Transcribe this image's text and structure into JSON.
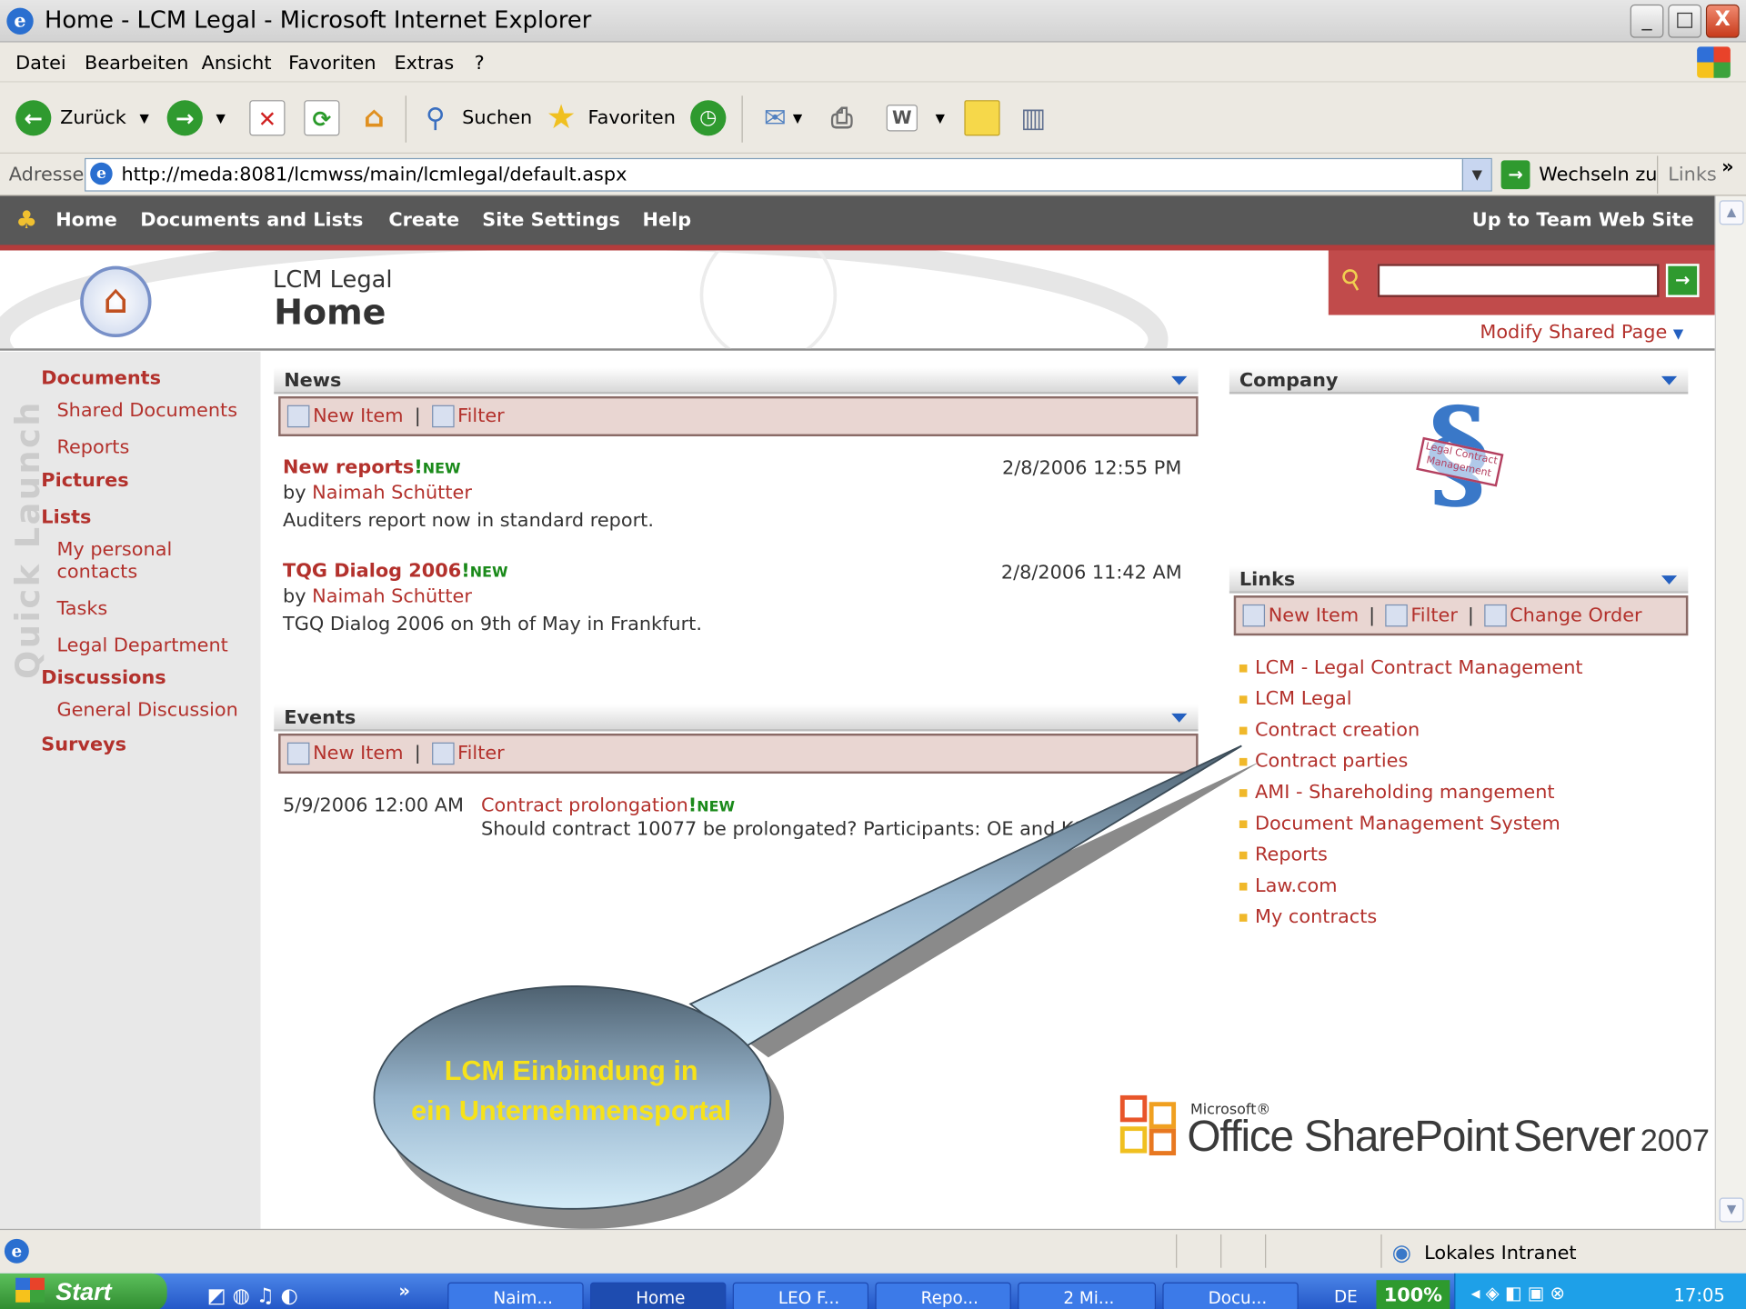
{
  "window": {
    "title": "Home - LCM Legal - Microsoft Internet Explorer",
    "min": "_",
    "max": "□",
    "close": "X"
  },
  "menu": [
    "Datei",
    "Bearbeiten",
    "Ansicht",
    "Favoriten",
    "Extras",
    "?"
  ],
  "toolbar": {
    "back": "Zurück",
    "search": "Suchen",
    "favorites": "Favoriten"
  },
  "address": {
    "label": "Adresse",
    "url": "http://meda:8081/lcmwss/main/lcmlegal/default.aspx",
    "go": "Wechseln zu",
    "links": "Links",
    "more": "»"
  },
  "sp_nav": {
    "home": "Home",
    "docs": "Documents and Lists",
    "create": "Create",
    "settings": "Site Settings",
    "help": "Help",
    "up": "Up to Team Web Site"
  },
  "header": {
    "site": "LCM Legal",
    "page": "Home",
    "modify": "Modify Shared Page"
  },
  "quicklaunch": {
    "label": "Quick Launch",
    "documents": "Documents",
    "shared_docs": "Shared Documents",
    "reports": "Reports",
    "pictures": "Pictures",
    "lists": "Lists",
    "contacts_1": "My personal",
    "contacts_2": "contacts",
    "tasks": "Tasks",
    "legal": "Legal Department",
    "discussions": "Discussions",
    "general": "General Discussion",
    "surveys": "Surveys"
  },
  "news": {
    "title": "News",
    "new_item": "New Item",
    "sep": "|",
    "filter": "Filter",
    "items": [
      {
        "title": "New reports",
        "badge": "NEW",
        "date": "2/8/2006 12:55 PM",
        "by": "by",
        "author": "Naimah Schütter",
        "body": "Auditers report now in standard report."
      },
      {
        "title": "TQG Dialog 2006",
        "badge": "NEW",
        "date": "2/8/2006 11:42 AM",
        "by": "by",
        "author": "Naimah Schütter",
        "body": "TGQ Dialog 2006 on 9th of May in Frankfurt."
      }
    ]
  },
  "events": {
    "title": "Events",
    "new_item": "New Item",
    "sep": "|",
    "filter": "Filter",
    "item": {
      "date": "5/9/2006 12:00 AM",
      "title": "Contract prolongation",
      "badge": "NEW",
      "body": "Should contract 10077 be prolongated? Participants: OE and KO"
    }
  },
  "company": {
    "title": "Company",
    "logo_text": "Legal Contract Management"
  },
  "links": {
    "title": "Links",
    "new_item": "New Item",
    "sep": "|",
    "filter": "Filter",
    "change_order": "Change Order",
    "items": [
      "LCM - Legal Contract Management",
      "LCM Legal",
      "Contract creation",
      "Contract parties",
      "AMI - Shareholding mangement",
      "Document Management System",
      "Reports",
      "Law.com",
      "My contracts"
    ]
  },
  "callout": {
    "line1": "LCM Einbindung in",
    "line2": "ein Unternehmensportal"
  },
  "brand": {
    "ms": "Microsoft®",
    "office": "Office SharePoint",
    "server": "Server",
    "year": "2007"
  },
  "status": {
    "zone": "Lokales Intranet"
  },
  "taskbar": {
    "start": "Start",
    "chev": "»",
    "tasks": [
      "Naim...",
      "Home",
      "LEO F...",
      "Repo...",
      "2 Mi...",
      "Docu..."
    ],
    "lang": "DE",
    "zoom": "100%",
    "clock": "17:05"
  },
  "colors": {
    "accent_red": "#b3312c",
    "nav_gray": "#585858",
    "callout_yellow": "#f6e21a"
  }
}
